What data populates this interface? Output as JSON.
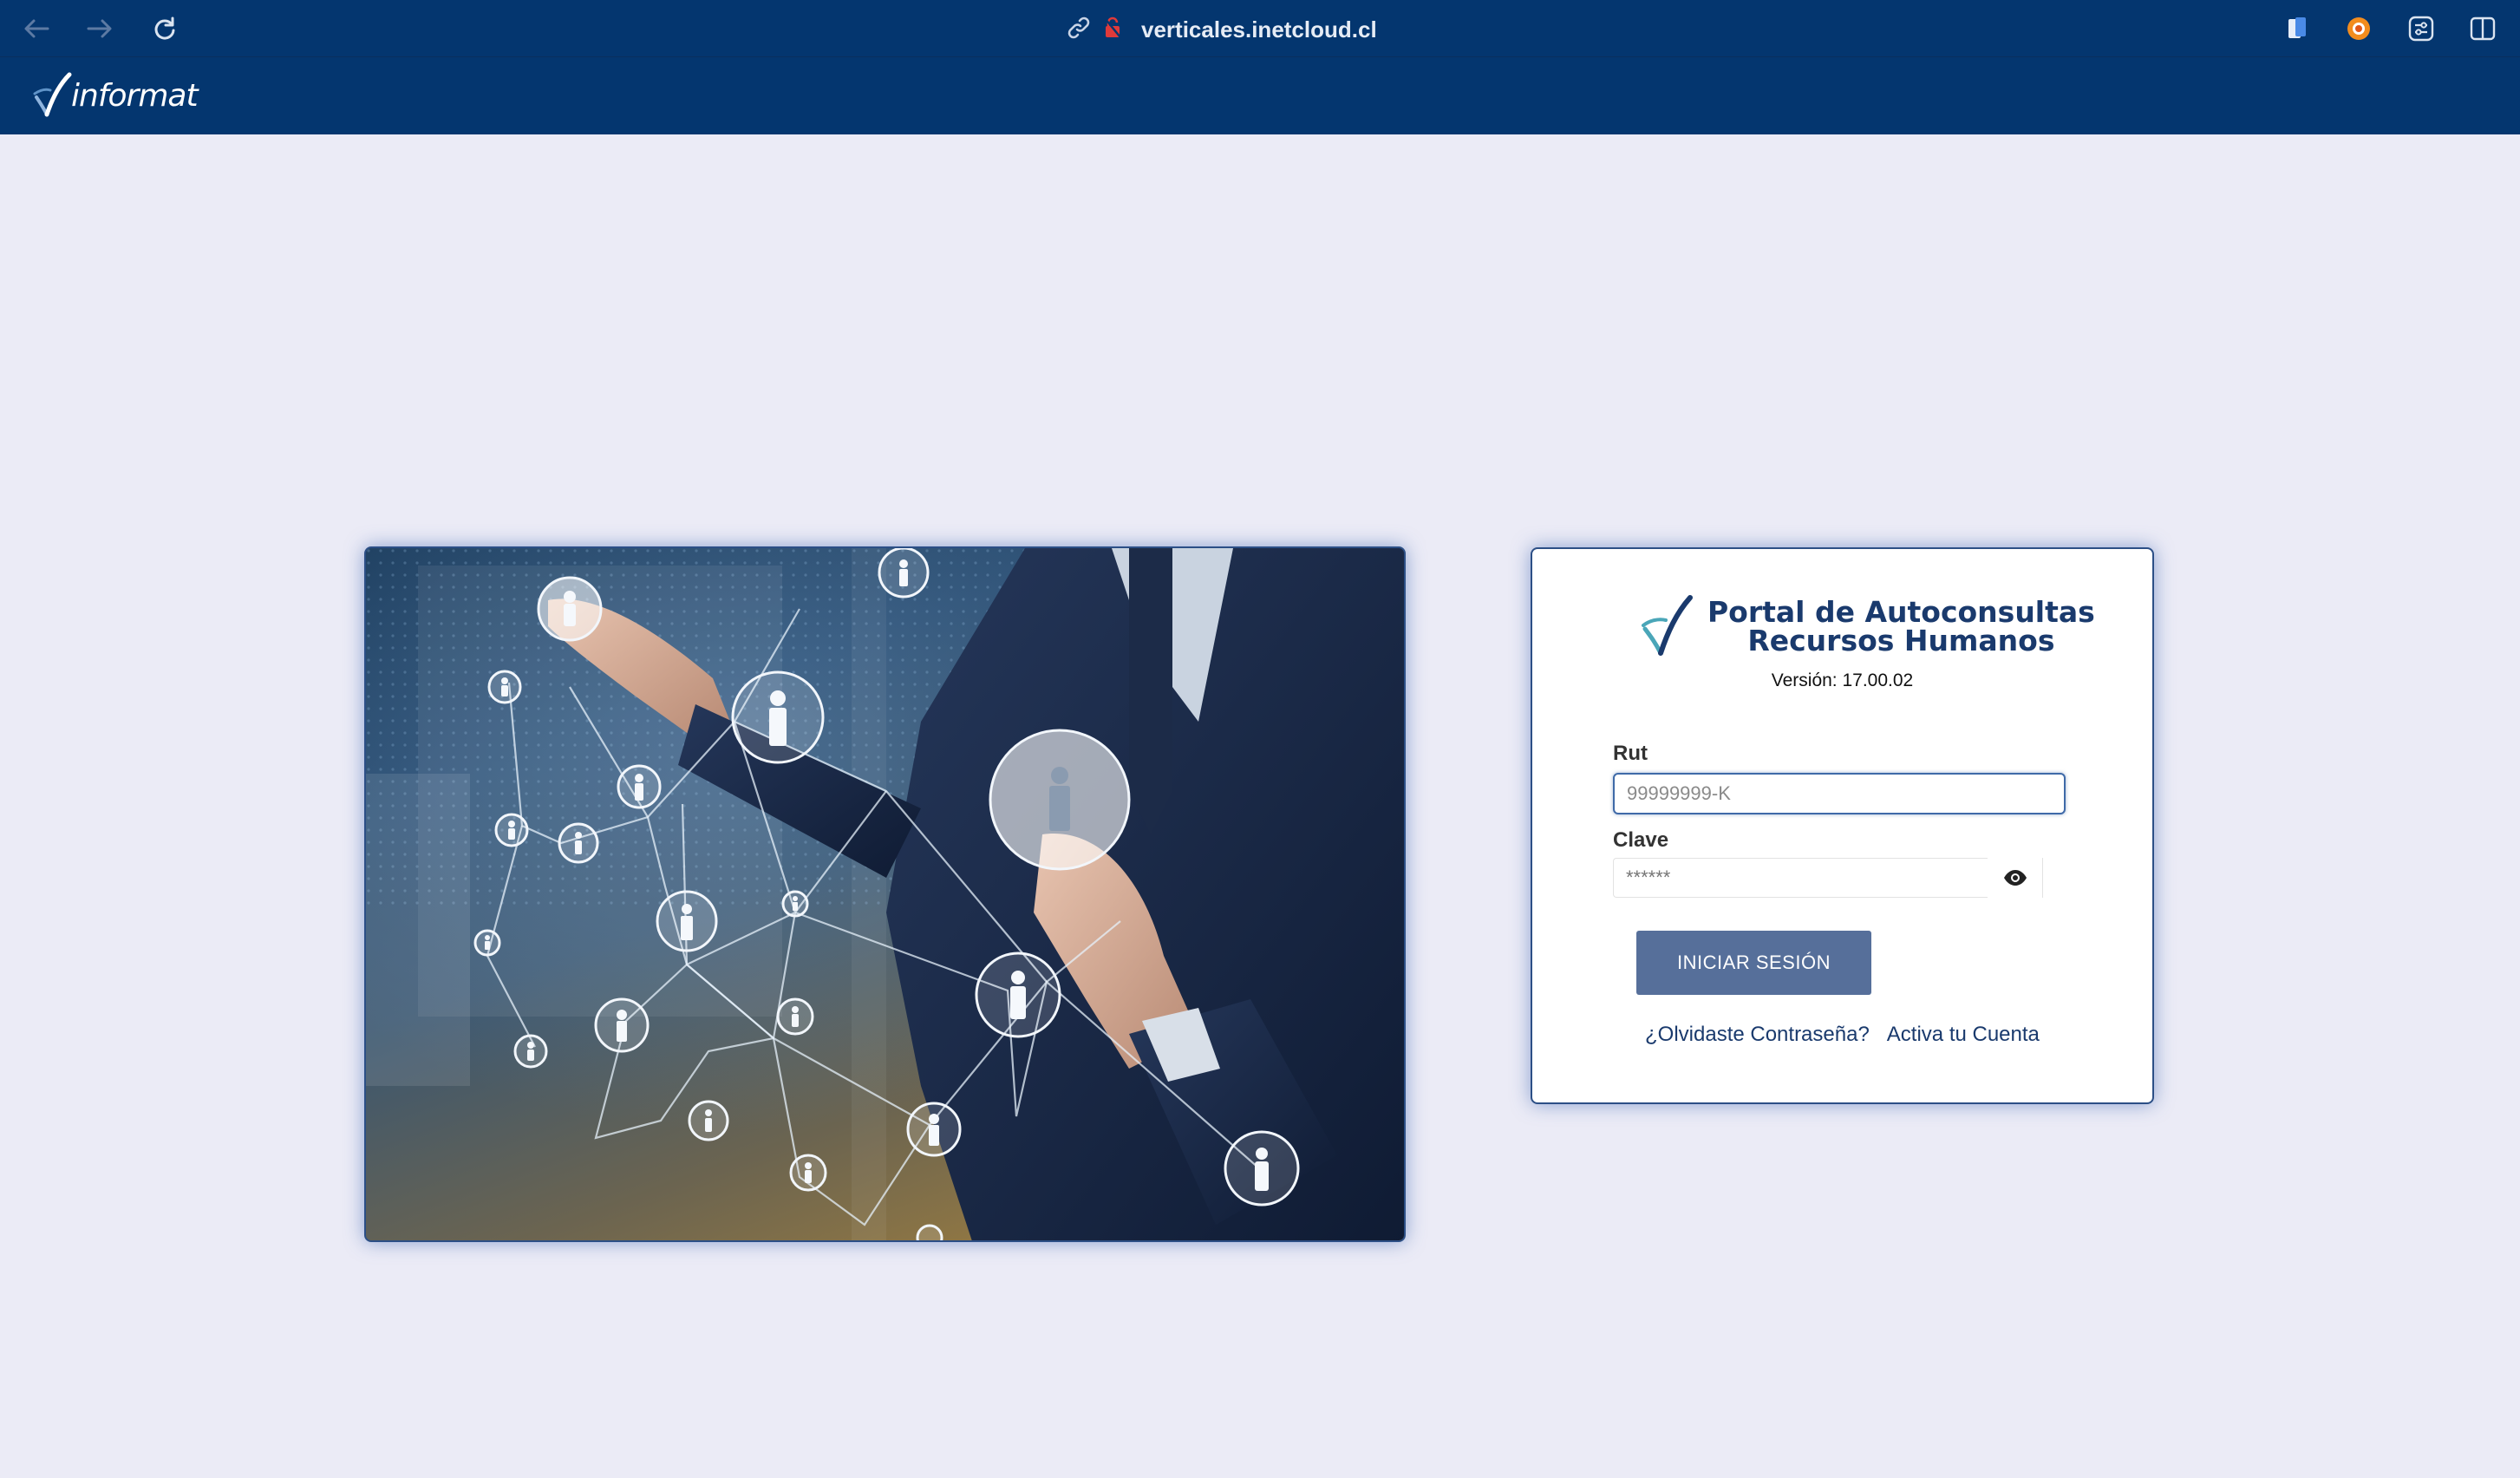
{
  "browser": {
    "url": "verticales.inetcloud.cl",
    "icons": [
      "back-arrow-icon",
      "forward-arrow-icon",
      "reload-icon",
      "link-icon",
      "lock-warning-icon",
      "bookmark-extension-icon",
      "orange-extension-icon",
      "sliders-extension-icon",
      "sidebar-toggle-icon"
    ]
  },
  "header": {
    "logo_text": "informat"
  },
  "login": {
    "title_line1": "Portal de Autoconsultas",
    "title_line2": "Recursos Humanos",
    "version": "Versión: 17.00.02",
    "rut_label": "Rut",
    "rut_placeholder": "99999999-K",
    "clave_label": "Clave",
    "clave_placeholder": "******",
    "submit_label": "INICIAR SESIÓN",
    "forgot_link": "¿Olvidaste Contraseña?",
    "activate_link": "Activa tu Cuenta"
  },
  "colors": {
    "header_bg": "#04366f",
    "page_bg": "#ebebf6",
    "brand_text": "#1a3a6d",
    "button_bg": "#566f9a",
    "accent_teal": "#4aa6b8"
  }
}
